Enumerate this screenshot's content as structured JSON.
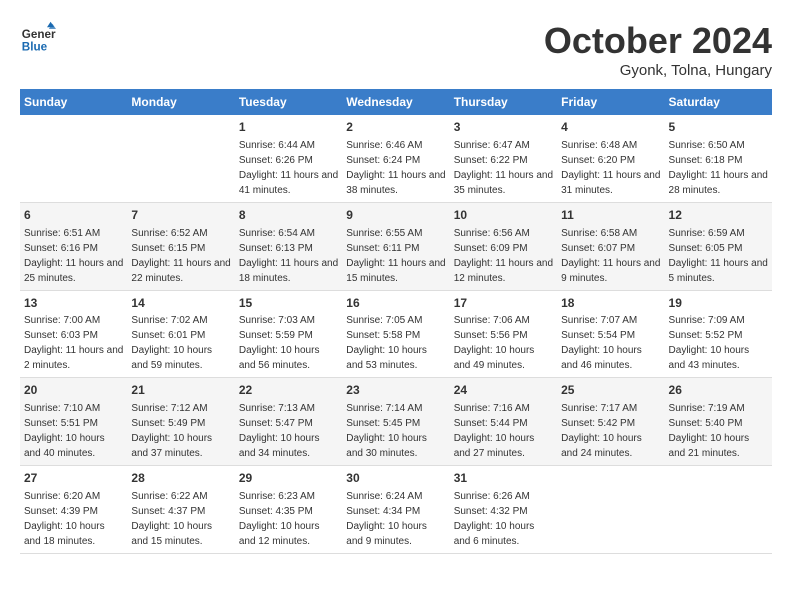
{
  "header": {
    "logo_line1": "General",
    "logo_line2": "Blue",
    "month_title": "October 2024",
    "location": "Gyonk, Tolna, Hungary"
  },
  "days_of_week": [
    "Sunday",
    "Monday",
    "Tuesday",
    "Wednesday",
    "Thursday",
    "Friday",
    "Saturday"
  ],
  "weeks": [
    [
      {
        "day": "",
        "info": ""
      },
      {
        "day": "",
        "info": ""
      },
      {
        "day": "1",
        "info": "Sunrise: 6:44 AM\nSunset: 6:26 PM\nDaylight: 11 hours and 41 minutes."
      },
      {
        "day": "2",
        "info": "Sunrise: 6:46 AM\nSunset: 6:24 PM\nDaylight: 11 hours and 38 minutes."
      },
      {
        "day": "3",
        "info": "Sunrise: 6:47 AM\nSunset: 6:22 PM\nDaylight: 11 hours and 35 minutes."
      },
      {
        "day": "4",
        "info": "Sunrise: 6:48 AM\nSunset: 6:20 PM\nDaylight: 11 hours and 31 minutes."
      },
      {
        "day": "5",
        "info": "Sunrise: 6:50 AM\nSunset: 6:18 PM\nDaylight: 11 hours and 28 minutes."
      }
    ],
    [
      {
        "day": "6",
        "info": "Sunrise: 6:51 AM\nSunset: 6:16 PM\nDaylight: 11 hours and 25 minutes."
      },
      {
        "day": "7",
        "info": "Sunrise: 6:52 AM\nSunset: 6:15 PM\nDaylight: 11 hours and 22 minutes."
      },
      {
        "day": "8",
        "info": "Sunrise: 6:54 AM\nSunset: 6:13 PM\nDaylight: 11 hours and 18 minutes."
      },
      {
        "day": "9",
        "info": "Sunrise: 6:55 AM\nSunset: 6:11 PM\nDaylight: 11 hours and 15 minutes."
      },
      {
        "day": "10",
        "info": "Sunrise: 6:56 AM\nSunset: 6:09 PM\nDaylight: 11 hours and 12 minutes."
      },
      {
        "day": "11",
        "info": "Sunrise: 6:58 AM\nSunset: 6:07 PM\nDaylight: 11 hours and 9 minutes."
      },
      {
        "day": "12",
        "info": "Sunrise: 6:59 AM\nSunset: 6:05 PM\nDaylight: 11 hours and 5 minutes."
      }
    ],
    [
      {
        "day": "13",
        "info": "Sunrise: 7:00 AM\nSunset: 6:03 PM\nDaylight: 11 hours and 2 minutes."
      },
      {
        "day": "14",
        "info": "Sunrise: 7:02 AM\nSunset: 6:01 PM\nDaylight: 10 hours and 59 minutes."
      },
      {
        "day": "15",
        "info": "Sunrise: 7:03 AM\nSunset: 5:59 PM\nDaylight: 10 hours and 56 minutes."
      },
      {
        "day": "16",
        "info": "Sunrise: 7:05 AM\nSunset: 5:58 PM\nDaylight: 10 hours and 53 minutes."
      },
      {
        "day": "17",
        "info": "Sunrise: 7:06 AM\nSunset: 5:56 PM\nDaylight: 10 hours and 49 minutes."
      },
      {
        "day": "18",
        "info": "Sunrise: 7:07 AM\nSunset: 5:54 PM\nDaylight: 10 hours and 46 minutes."
      },
      {
        "day": "19",
        "info": "Sunrise: 7:09 AM\nSunset: 5:52 PM\nDaylight: 10 hours and 43 minutes."
      }
    ],
    [
      {
        "day": "20",
        "info": "Sunrise: 7:10 AM\nSunset: 5:51 PM\nDaylight: 10 hours and 40 minutes."
      },
      {
        "day": "21",
        "info": "Sunrise: 7:12 AM\nSunset: 5:49 PM\nDaylight: 10 hours and 37 minutes."
      },
      {
        "day": "22",
        "info": "Sunrise: 7:13 AM\nSunset: 5:47 PM\nDaylight: 10 hours and 34 minutes."
      },
      {
        "day": "23",
        "info": "Sunrise: 7:14 AM\nSunset: 5:45 PM\nDaylight: 10 hours and 30 minutes."
      },
      {
        "day": "24",
        "info": "Sunrise: 7:16 AM\nSunset: 5:44 PM\nDaylight: 10 hours and 27 minutes."
      },
      {
        "day": "25",
        "info": "Sunrise: 7:17 AM\nSunset: 5:42 PM\nDaylight: 10 hours and 24 minutes."
      },
      {
        "day": "26",
        "info": "Sunrise: 7:19 AM\nSunset: 5:40 PM\nDaylight: 10 hours and 21 minutes."
      }
    ],
    [
      {
        "day": "27",
        "info": "Sunrise: 6:20 AM\nSunset: 4:39 PM\nDaylight: 10 hours and 18 minutes."
      },
      {
        "day": "28",
        "info": "Sunrise: 6:22 AM\nSunset: 4:37 PM\nDaylight: 10 hours and 15 minutes."
      },
      {
        "day": "29",
        "info": "Sunrise: 6:23 AM\nSunset: 4:35 PM\nDaylight: 10 hours and 12 minutes."
      },
      {
        "day": "30",
        "info": "Sunrise: 6:24 AM\nSunset: 4:34 PM\nDaylight: 10 hours and 9 minutes."
      },
      {
        "day": "31",
        "info": "Sunrise: 6:26 AM\nSunset: 4:32 PM\nDaylight: 10 hours and 6 minutes."
      },
      {
        "day": "",
        "info": ""
      },
      {
        "day": "",
        "info": ""
      }
    ]
  ]
}
